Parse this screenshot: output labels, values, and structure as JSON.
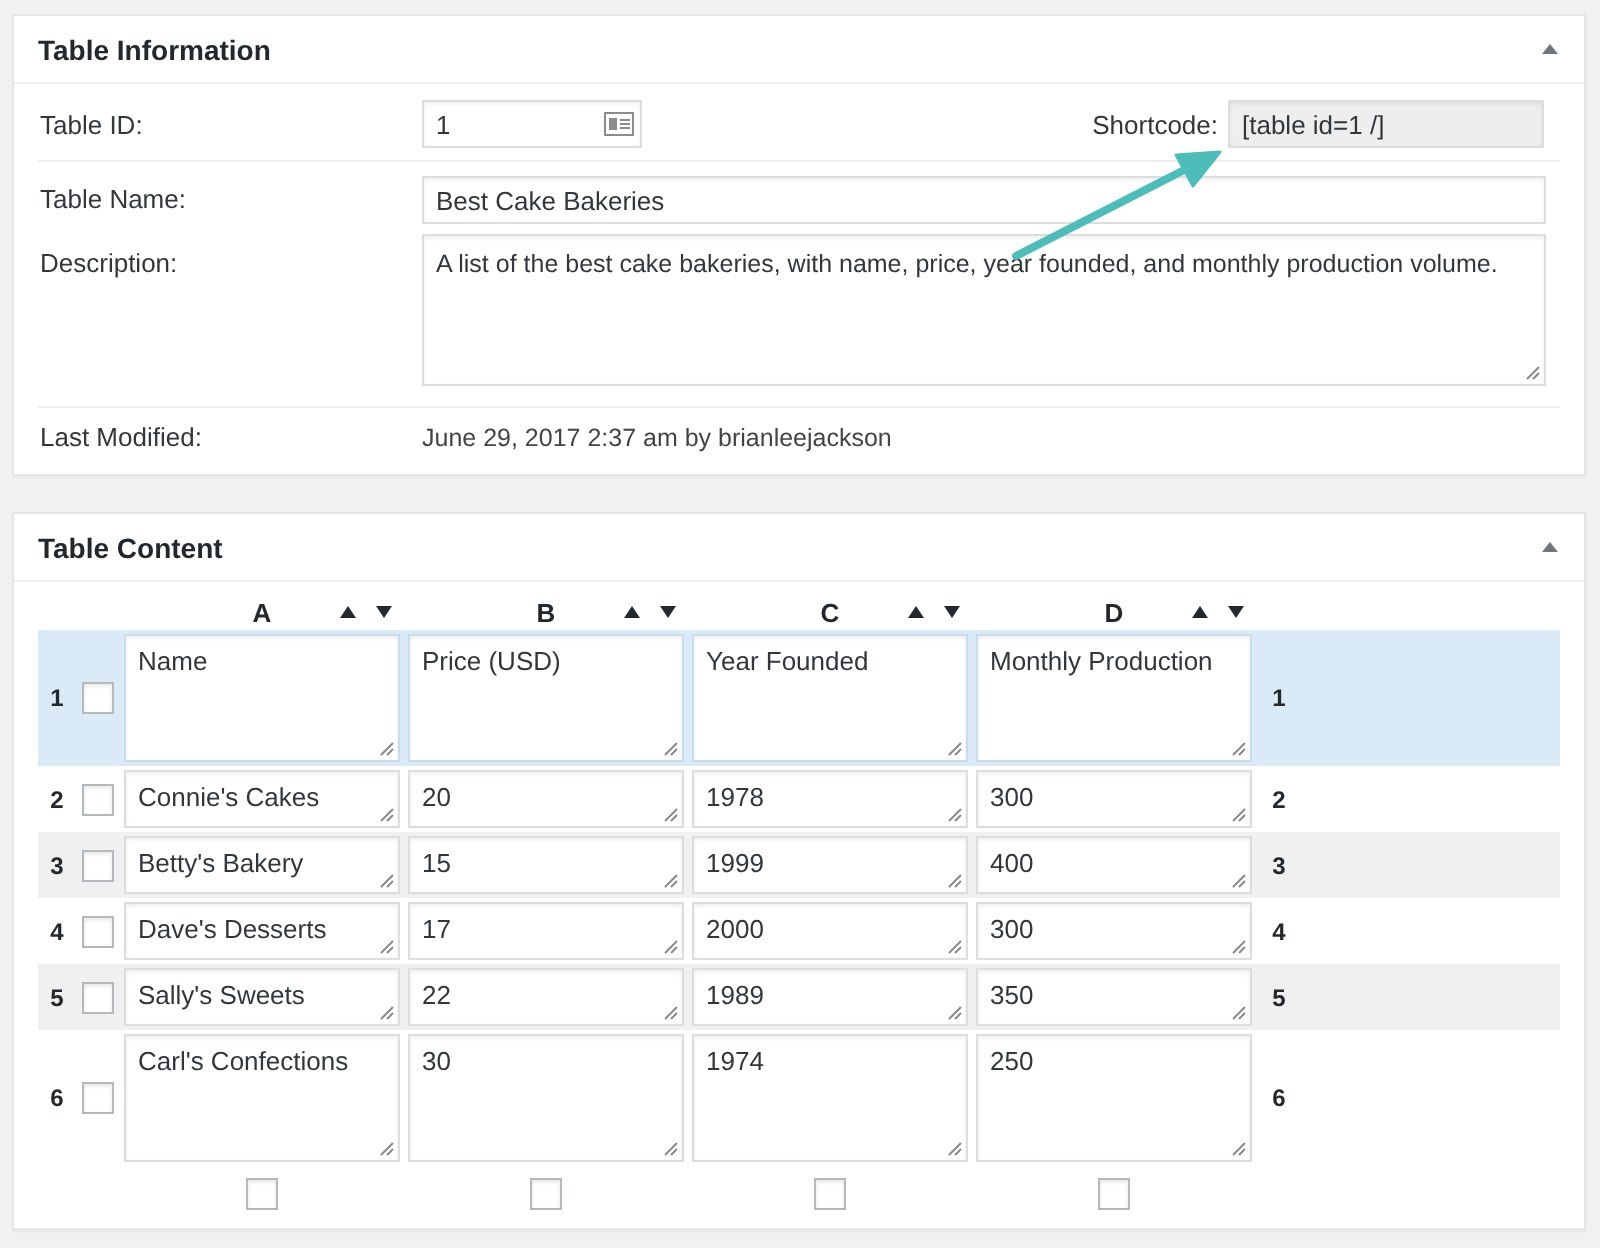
{
  "table_information": {
    "title": "Table Information",
    "expanded": true,
    "table_id": {
      "label": "Table ID:",
      "value": "1"
    },
    "shortcode": {
      "label": "Shortcode:",
      "value": "[table id=1 /]"
    },
    "table_name": {
      "label": "Table Name:",
      "value": "Best Cake Bakeries"
    },
    "description": {
      "label": "Description:",
      "value": "A list of the best cake bakeries, with name, price, year founded, and monthly production volume."
    },
    "last_modified": {
      "label": "Last Modified:",
      "value": "June 29, 2017 2:37 am by brianleejackson"
    }
  },
  "table_content": {
    "title": "Table Content",
    "expanded": true,
    "columns": [
      {
        "label": "A",
        "checked": false
      },
      {
        "label": "B",
        "checked": false
      },
      {
        "label": "C",
        "checked": false
      },
      {
        "label": "D",
        "checked": false
      }
    ],
    "rows": [
      {
        "number": "1",
        "number_end": "1",
        "head": true,
        "expanded": true,
        "checked": false,
        "cells": [
          "Name",
          "Price (USD)",
          "Year Founded",
          "Monthly Production"
        ]
      },
      {
        "number": "2",
        "number_end": "2",
        "head": false,
        "expanded": false,
        "checked": false,
        "cells": [
          "Connie's Cakes",
          "20",
          "1978",
          "300"
        ]
      },
      {
        "number": "3",
        "number_end": "3",
        "head": false,
        "expanded": false,
        "checked": false,
        "cells": [
          "Betty's Bakery",
          "15",
          "1999",
          "400"
        ]
      },
      {
        "number": "4",
        "number_end": "4",
        "head": false,
        "expanded": false,
        "checked": false,
        "cells": [
          "Dave's Desserts",
          "17",
          "2000",
          "300"
        ]
      },
      {
        "number": "5",
        "number_end": "5",
        "head": false,
        "expanded": false,
        "checked": false,
        "cells": [
          "Sally's Sweets",
          "22",
          "1989",
          "350"
        ]
      },
      {
        "number": "6",
        "number_end": "6",
        "head": false,
        "expanded": true,
        "checked": false,
        "cells": [
          "Carl's Confections",
          "30",
          "1974",
          "250"
        ]
      }
    ]
  }
}
